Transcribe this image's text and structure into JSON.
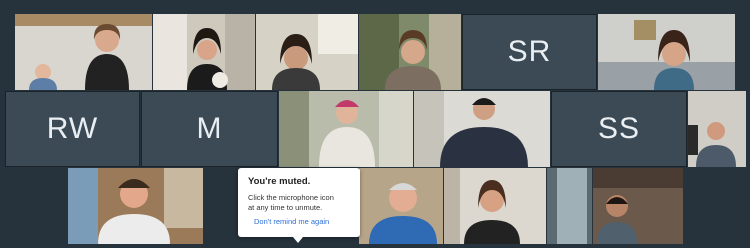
{
  "participants": [
    {
      "type": "video",
      "name": "participant-1"
    },
    {
      "type": "video",
      "name": "participant-2"
    },
    {
      "type": "video",
      "name": "participant-3"
    },
    {
      "type": "video",
      "name": "participant-4"
    },
    {
      "type": "initials",
      "initials": "SR"
    },
    {
      "type": "video",
      "name": "participant-6"
    },
    {
      "type": "initials",
      "initials": "RW"
    },
    {
      "type": "initials",
      "initials": "M"
    },
    {
      "type": "video",
      "name": "participant-9"
    },
    {
      "type": "video",
      "name": "participant-10"
    },
    {
      "type": "initials",
      "initials": "SS"
    },
    {
      "type": "video",
      "name": "participant-12"
    },
    {
      "type": "video",
      "name": "participant-13"
    },
    {
      "type": "video",
      "name": "participant-14"
    },
    {
      "type": "video",
      "name": "participant-15"
    },
    {
      "type": "video",
      "name": "participant-16"
    }
  ],
  "muted_tooltip": {
    "title": "You're muted.",
    "body_line1": "Click the microphone icon",
    "body_line2": "at any time to unmute.",
    "link": "Don't remind me again"
  },
  "colors": {
    "background": "#26323c",
    "initials_tile": "#3b4a55",
    "link": "#2d6fd6"
  }
}
